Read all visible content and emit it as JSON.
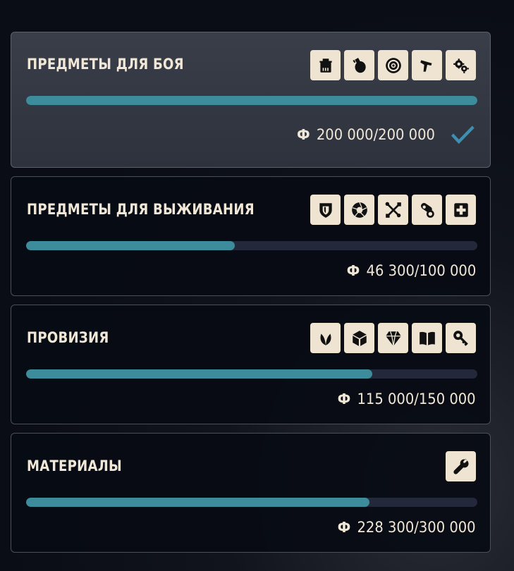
{
  "categories": [
    {
      "title": "ПРЕДМЕТЫ ДЛЯ БОЯ",
      "icons": [
        "ammo-crate-icon",
        "grenade-icon",
        "target-icon",
        "pistol-icon",
        "gears-icon"
      ],
      "progress": 1.0,
      "currency_symbol": "Ф",
      "amount": "200 000/200 000",
      "completed": true
    },
    {
      "title": "ПРЕДМЕТЫ ДЛЯ ВЫЖИВАНИЯ",
      "icons": [
        "shield-icon",
        "aperture-icon",
        "crossed-tools-icon",
        "pills-icon",
        "medkit-icon"
      ],
      "progress": 0.463,
      "currency_symbol": "Ф",
      "amount": "46 300/100 000",
      "completed": false
    },
    {
      "title": "ПРОВИЗИЯ",
      "icons": [
        "leaf-icon",
        "box-icon",
        "gem-icon",
        "book-icon",
        "key-icon"
      ],
      "progress": 0.767,
      "currency_symbol": "Ф",
      "amount": "115 000/150 000",
      "completed": false
    },
    {
      "title": "МАТЕРИАЛЫ",
      "icons": [
        "wrench-icon"
      ],
      "progress": 0.761,
      "currency_symbol": "Ф",
      "amount": "228 300/300 000",
      "completed": false
    }
  ],
  "colors": {
    "accent": "#3d8c9b",
    "bar_track": "#23283a",
    "icon_bg": "#efe4d1",
    "text": "#f1e7d6",
    "check": "#3d8fb0"
  }
}
